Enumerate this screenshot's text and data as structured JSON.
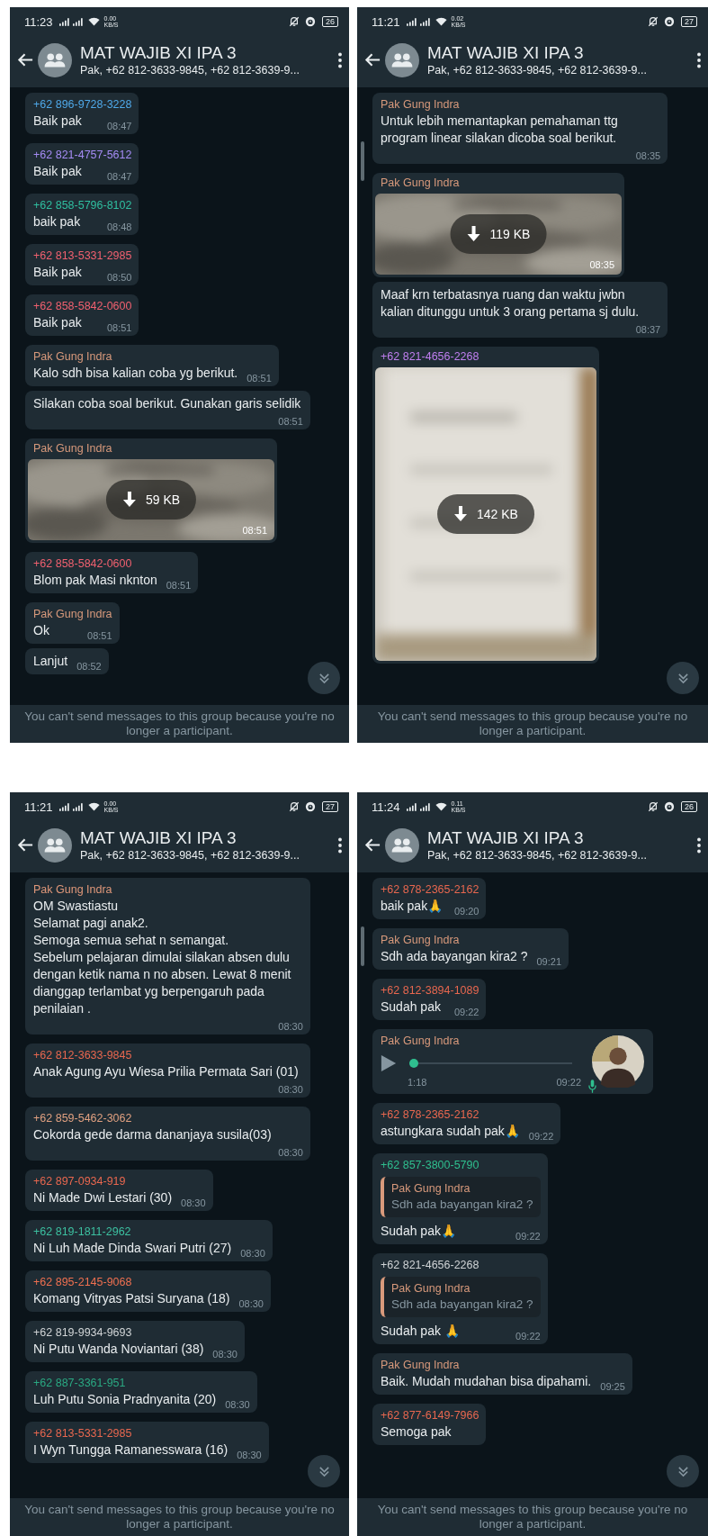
{
  "panels": [
    {
      "status_bar": {
        "time": "11:23",
        "speed": "0.00",
        "speed_unit": "KB/S",
        "battery": "26"
      },
      "header": {
        "title": "MAT WAJIB XI IPA 3",
        "subtitle": "Pak, +62 812-3633-9845, +62 812-3639-9..."
      },
      "scroll_indicator": false,
      "messages": [
        {
          "kind": "text",
          "sender": "+62 896-9728-3228",
          "color": "#4fa8e8",
          "text": "Baik pak",
          "time": "08:47"
        },
        {
          "kind": "text",
          "sender": "+62 821-4757-5612",
          "color": "#a58cf5",
          "text": "Baik pak",
          "time": "08:47"
        },
        {
          "kind": "text",
          "sender": "+62 858-5796-8102",
          "color": "#2fbfa0",
          "text": "baik pak",
          "time": "08:48"
        },
        {
          "kind": "text",
          "sender": "+62 813-5331-2985",
          "color": "#f0606f",
          "text": "Baik pak",
          "time": "08:50"
        },
        {
          "kind": "text",
          "sender": "+62 858-5842-0600",
          "color": "#f0606f",
          "text": "Baik pak",
          "time": "08:51"
        },
        {
          "kind": "text",
          "sender": "Pak Gung Indra",
          "color": "#d99a7c",
          "text": "Kalo sdh bisa kalian coba yg berikut.",
          "time": "08:51"
        },
        {
          "kind": "text",
          "text": "Silakan coba soal berikut. Gunakan garis selidik",
          "time": "08:51"
        },
        {
          "sender": "Pak Gung Indra",
          "color": "#d99a7c",
          "size": "59 KB",
          "time": "08:51"
        },
        {
          "kind": "text",
          "sender": "+62 858-5842-0600",
          "color": "#f0606f",
          "text": "Blom pak Masi nknton",
          "time": "08:51"
        },
        {
          "kind": "text",
          "sender": "Pak Gung Indra",
          "color": "#d99a7c",
          "text": "Ok",
          "time": "08:51"
        },
        {
          "kind": "text",
          "text": "Lanjut",
          "time": "08:52"
        }
      ],
      "footer": "You can't send messages to this group because you're no longer a participant."
    },
    {
      "status_bar": {
        "time": "11:21",
        "speed": "0.02",
        "speed_unit": "KB/S",
        "battery": "27"
      },
      "header": {
        "title": "MAT WAJIB XI IPA 3",
        "subtitle": "Pak, +62 812-3633-9845, +62 812-3639-9..."
      },
      "scroll_indicator": true,
      "messages": [
        {
          "kind": "text",
          "sender": "Pak Gung Indra",
          "color": "#d99a7c",
          "text": "Untuk lebih memantapkan pemahaman ttg program linear silakan dicoba soal berikut.",
          "time": "08:35"
        },
        {
          "sender": "Pak Gung Indra",
          "color": "#d99a7c",
          "size": "119 KB",
          "time": "08:35"
        },
        {
          "kind": "text",
          "text": "Maaf krn terbatasnya ruang dan waktu jwbn kalian ditunggu untuk 3 orang pertama sj dulu.",
          "time": "08:37"
        },
        {
          "kind": "tall_image",
          "sender": "+62 821-4656-2268",
          "color": "#c07ff0",
          "size": "142 KB"
        }
      ],
      "footer": "You can't send messages to this group because you're no longer a participant."
    },
    {
      "status_bar": {
        "time": "11:21",
        "speed": "0.00",
        "speed_unit": "KB/S",
        "battery": "27"
      },
      "header": {
        "title": "MAT WAJIB XI IPA 3",
        "subtitle": "Pak, +62 812-3633-9845, +62 812-3639-9..."
      },
      "scroll_indicator": false,
      "messages": [
        {
          "kind": "text",
          "sender": "Pak Gung Indra",
          "color": "#e0987a",
          "text": "OM Swastiastu\nSelamat pagi anak2.\nSemoga semua sehat n semangat.\nSebelum pelajaran dimulai silakan absen dulu dengan ketik nama n no absen. Lewat 8 menit dianggap terlambat yg berpengaruh pada penilaian .",
          "time": "08:30"
        },
        {
          "kind": "text",
          "sender": "+62 812-3633-9845",
          "color": "#e8674f",
          "text": "Anak Agung Ayu Wiesa Prilia Permata Sari (01)",
          "time": "08:30"
        },
        {
          "kind": "text",
          "sender": "+62 859-5462-3062",
          "color": "#e0a080",
          "text": "Cokorda gede darma dananjaya susila(03)",
          "time": "08:30"
        },
        {
          "kind": "text",
          "sender": "+62 897-0934-919",
          "color": "#e8674f",
          "text": "Ni Made Dwi Lestari (30)",
          "time": "08:30"
        },
        {
          "kind": "text",
          "sender": "+62 819-1811-2962",
          "color": "#3cc0a0",
          "text": "Ni Luh Made Dinda Swari Putri (27)",
          "time": "08:30"
        },
        {
          "kind": "text",
          "sender": "+62 895-2145-9068",
          "color": "#f07050",
          "text": "Komang Vitryas Patsi Suryana (18)",
          "time": "08:30"
        },
        {
          "kind": "text",
          "sender": "+62 819-9934-9693",
          "color": "#d0d4d6",
          "text": "Ni Putu Wanda Noviantari (38)",
          "time": "08:30"
        },
        {
          "kind": "text",
          "sender": "+62 887-3361-951",
          "color": "#2aa882",
          "text": "Luh Putu Sonia Pradnyanita (20)",
          "time": "08:30"
        },
        {
          "kind": "text",
          "sender": "+62 813-5331-2985",
          "color": "#e8674f",
          "text": "I Wyn Tungga Ramanesswara (16)",
          "time": "08:30"
        }
      ],
      "footer": "You can't send messages to this group because you're no longer a participant."
    },
    {
      "status_bar": {
        "time": "11:24",
        "speed": "0.11",
        "speed_unit": "KB/S",
        "battery": "26"
      },
      "header": {
        "title": "MAT WAJIB XI IPA 3",
        "subtitle": "Pak, +62 812-3633-9845, +62 812-3639-9..."
      },
      "scroll_indicator": true,
      "messages": [
        {
          "kind": "text",
          "sender": "+62 878-2365-2162",
          "color": "#e8674f",
          "text": "baik pak🙏",
          "time": "09:20"
        },
        {
          "kind": "text",
          "sender": "Pak Gung Indra",
          "color": "#d99a7c",
          "text": "Sdh ada bayangan kira2 ?",
          "time": "09:21"
        },
        {
          "kind": "text",
          "sender": "+62 812-3894-1089",
          "color": "#e8674f",
          "text": "Sudah pak",
          "time": "09:22"
        },
        {
          "kind": "voice",
          "sender": "Pak Gung Indra",
          "color": "#d99a7c",
          "duration": "1:18",
          "level": 0,
          "time": "09:22"
        },
        {
          "kind": "text",
          "sender": "+62 878-2365-2162",
          "color": "#e8674f",
          "text": "astungkara sudah pak🙏",
          "time": "09:22"
        },
        {
          "kind": "reply",
          "sender": "+62 857-3800-5790",
          "color": "#2fbf8f",
          "quote": {
            "sender": "Pak Gung Indra",
            "color": "#d99a7c",
            "text": "Sdh ada bayangan kira2 ?"
          },
          "text": "Sudah pak🙏",
          "time": "09:22"
        },
        {
          "kind": "reply",
          "sender": "+62 821-4656-2268",
          "color": "#d0d4d6",
          "quote": {
            "sender": "Pak Gung Indra",
            "color": "#d99a7c",
            "text": "Sdh ada bayangan kira2 ?"
          },
          "text": "Sudah pak 🙏",
          "time": "09:22"
        },
        {
          "kind": "text",
          "sender": "Pak Gung Indra",
          "color": "#d99a7c",
          "text": "Baik. Mudah mudahan bisa dipahami.",
          "time": "09:25"
        },
        {
          "kind": "text",
          "sender": "+62 877-6149-7966",
          "color": "#e8674f",
          "text": "Semoga pak"
        }
      ],
      "footer": "You can't send messages to this group because you're no longer a participant."
    }
  ]
}
